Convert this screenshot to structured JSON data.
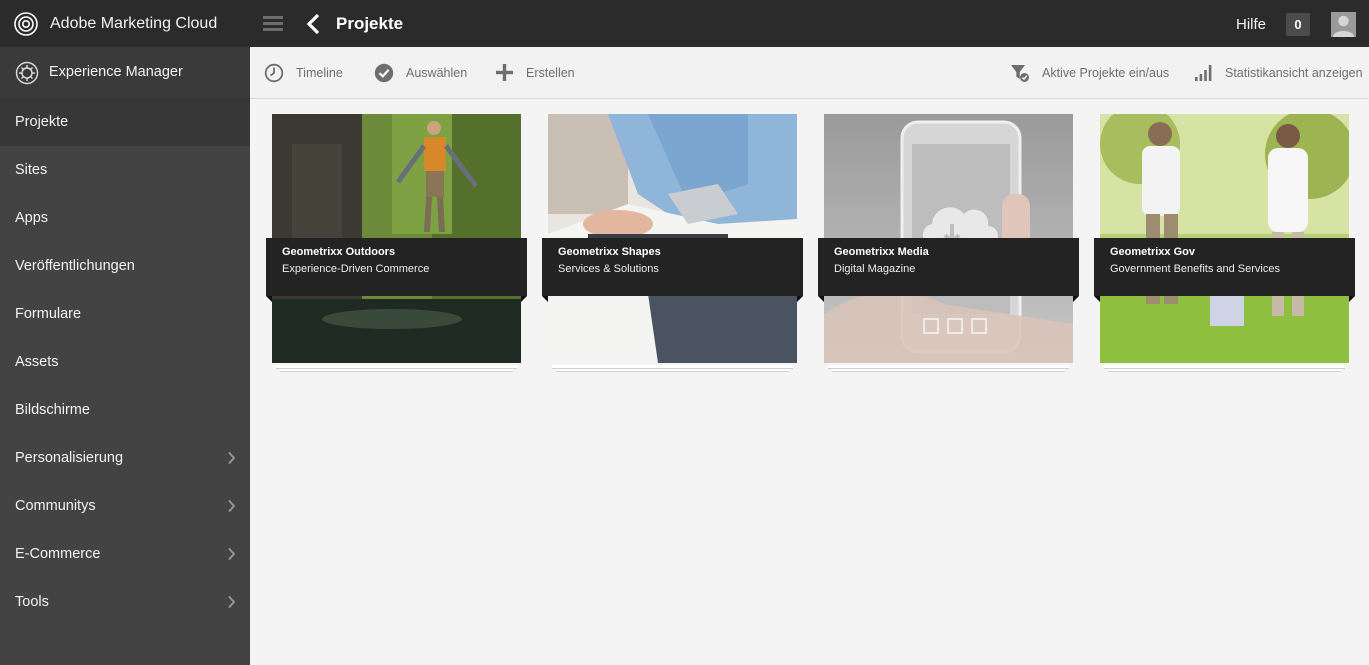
{
  "topbar": {
    "brand": "Adobe Marketing Cloud",
    "page_title": "Projekte",
    "help": "Hilfe",
    "notifications": "0"
  },
  "sidebar": {
    "header": "Experience Manager",
    "items": [
      {
        "label": "Projekte",
        "active": true,
        "has_children": false
      },
      {
        "label": "Sites",
        "has_children": false
      },
      {
        "label": "Apps",
        "has_children": false
      },
      {
        "label": "Veröffentlichungen",
        "has_children": false
      },
      {
        "label": "Formulare",
        "has_children": false
      },
      {
        "label": "Assets",
        "has_children": false
      },
      {
        "label": "Bildschirme",
        "has_children": false
      },
      {
        "label": "Personalisierung",
        "has_children": true
      },
      {
        "label": "Communitys",
        "has_children": true
      },
      {
        "label": "E-Commerce",
        "has_children": true
      },
      {
        "label": "Tools",
        "has_children": true
      }
    ]
  },
  "actions": {
    "timeline": "Timeline",
    "select": "Auswählen",
    "create": "Erstellen",
    "toggle_active": "Aktive Projekte ein/aus",
    "stats_view": "Statistikansicht anzeigen"
  },
  "projects": [
    {
      "title": "Geometrixx Outdoors",
      "subtitle": "Experience-Driven Commerce"
    },
    {
      "title": "Geometrixx Shapes",
      "subtitle": "Services & Solutions"
    },
    {
      "title": "Geometrixx Media",
      "subtitle": "Digital Magazine"
    },
    {
      "title": "Geometrixx Gov",
      "subtitle": "Government Benefits and Services"
    }
  ],
  "colors": {
    "topbar": "#2b2b2b",
    "sidebar": "#434343",
    "card_label": "#232323",
    "icon_gray": "#6e6e6e"
  }
}
